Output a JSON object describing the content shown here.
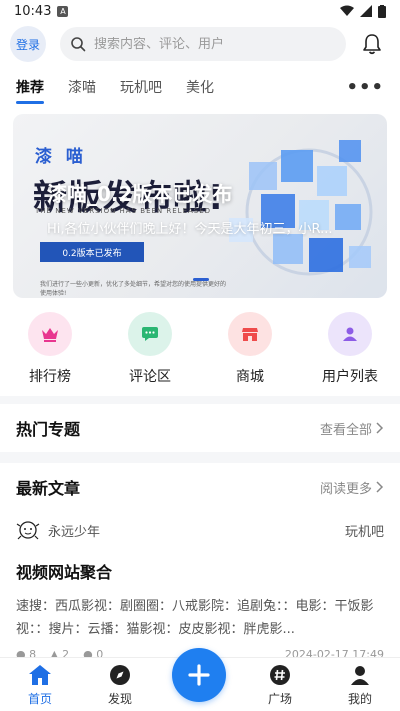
{
  "status_bar": {
    "time": "10:43",
    "badge": "A"
  },
  "header": {
    "login_label": "登录",
    "search_placeholder": "搜索内容、评论、用户"
  },
  "tabs": [
    {
      "label": "推荐",
      "active": true
    },
    {
      "label": "漆喵",
      "active": false
    },
    {
      "label": "玩机吧",
      "active": false
    },
    {
      "label": "美化",
      "active": false
    }
  ],
  "tabs_more": "•••",
  "banner": {
    "title": "漆喵_0.2版本已发布",
    "description": "Hi,各位小伙伴们晚上好！今天是大年初三，小R...",
    "image_brand": "漆 喵",
    "image_headline": "新版发布啦!",
    "image_subheadline": "THE NEW VERSION HAS BEEN RELEASED",
    "image_pill": "0.2版本已发布",
    "image_note": "我们进行了一些小更新，优化了多处细节，希望对您的使用提供更好的使用体验!"
  },
  "quick_links": [
    {
      "label": "排行榜",
      "icon": "crown-icon",
      "bg": "#fde4ef",
      "fg": "#e8368f"
    },
    {
      "label": "评论区",
      "icon": "comment-icon",
      "bg": "#dcf3ea",
      "fg": "#2bb673"
    },
    {
      "label": "商城",
      "icon": "shop-icon",
      "bg": "#fde2e2",
      "fg": "#ef4b4b"
    },
    {
      "label": "用户列表",
      "icon": "user-icon",
      "bg": "#ece4fb",
      "fg": "#8d5ce6"
    }
  ],
  "hot_topics": {
    "title": "热门专题",
    "more": "查看全部"
  },
  "latest": {
    "title": "最新文章",
    "more": "阅读更多",
    "article": {
      "author": "永远少年",
      "circle": "玩机吧",
      "title": "视频网站聚合",
      "body": "速搜：西瓜影视：剧圈圈：八戒影院：追剧兔：：电影：干饭影视：：搜片：云播：猫影视：皮皮影视：胖虎影...",
      "views": "8",
      "likes": "2",
      "comments": "0",
      "date": "2024-02-17 17:49"
    }
  },
  "bottom_nav": [
    {
      "label": "首页",
      "icon": "home-icon",
      "active": true
    },
    {
      "label": "发现",
      "icon": "compass-icon",
      "active": false
    },
    {
      "label": "广场",
      "icon": "hashtag-icon",
      "active": false
    },
    {
      "label": "我的",
      "icon": "profile-icon",
      "active": false
    }
  ],
  "colors": {
    "accent": "#1f6fe5",
    "fab": "#1f7ff0"
  }
}
